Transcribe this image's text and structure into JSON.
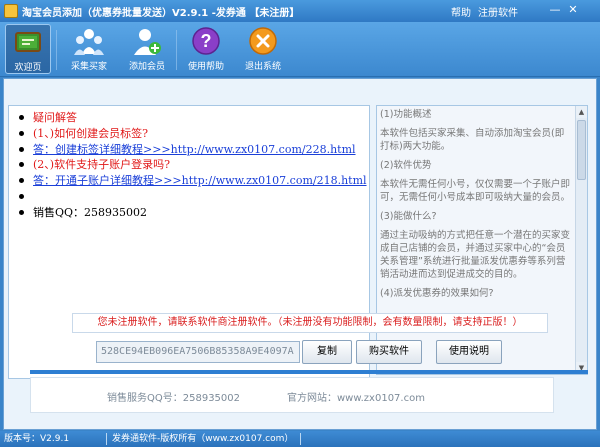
{
  "window": {
    "title": "淘宝会员添加（优惠券批量发送）V2.9.1 -发券通  【未注册】",
    "menu": {
      "help": "帮助",
      "register": "注册软件"
    }
  },
  "toolbar": {
    "items": [
      {
        "label": "欢迎页"
      },
      {
        "label": "采集买家"
      },
      {
        "label": "添加会员"
      },
      {
        "label": "使用帮助"
      },
      {
        "label": "退出系统"
      }
    ]
  },
  "faq": {
    "items": [
      {
        "text": "疑问解答"
      },
      {
        "text": "(1、)如何创建会员标签?"
      },
      {
        "text": "答：创建标签详细教程>>>http://www.zx0107.com/228.html"
      },
      {
        "text": "(2、)软件支持子账户登录吗?"
      },
      {
        "text": "答：开通子账户详细教程>>>http://www.zx0107.com/218.html"
      },
      {
        "text": ""
      },
      {
        "text": "销售QQ：258935002"
      }
    ]
  },
  "intro": {
    "paragraphs": [
      "(1)功能概述",
      "本软件包括买家采集、自动添加淘宝会员(即打标)两大功能。",
      "(2)软件优势",
      "本软件无需任何小号，仅仅需要一个子账户即可，无需任何小号成本即可吸纳大量的会员。",
      "(3)能做什么?",
      "通过主动吸纳的方式把任意一个潜在的买家变成自己店铺的会员，并通过买家中心的“会员关系管理”系统进行批量派发优惠券等系列营销活动进而达到促进成交的目的。",
      "(4)派发优惠券的效果如何?"
    ]
  },
  "register": {
    "notice": "您未注册软件，请联系软件商注册软件。（未注册没有功能限制，会有数量限制，请支持正版！）",
    "machine_code": "528CE94EB096EA7506B85358A9E4097A",
    "copy_label": "复制",
    "buy_label": "购买软件",
    "guide_label": "使用说明"
  },
  "info": {
    "sales_qq": "销售服务QQ号：258935002",
    "website": "官方网站：www.zx0107.com"
  },
  "status": {
    "version": "版本号：V2.9.1",
    "copyright": "发券通软件-版权所有（www.zx0107.com）"
  }
}
